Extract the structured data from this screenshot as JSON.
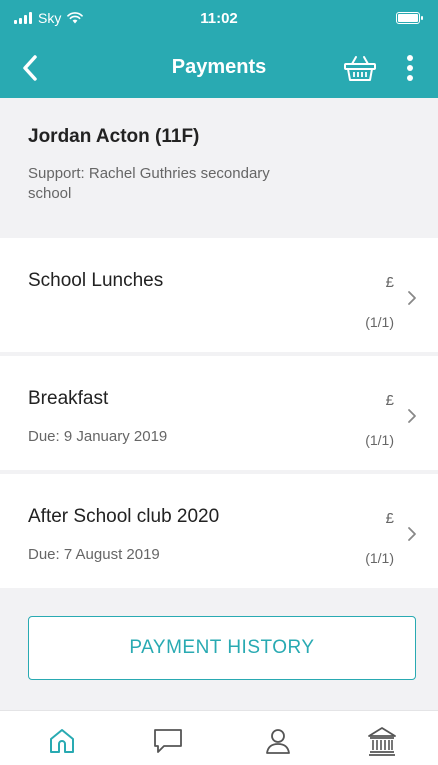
{
  "status_bar": {
    "carrier": "Sky",
    "time": "11:02",
    "icons": [
      "signal-icon",
      "wifi-icon",
      "battery-icon"
    ]
  },
  "nav": {
    "title": "Payments",
    "icons": [
      "back-chevron-icon",
      "basket-icon",
      "more-vertical-icon"
    ]
  },
  "student": {
    "name": "Jordan Acton (11F)",
    "support": "Support: Rachel Guthries secondary school"
  },
  "payments": [
    {
      "title": "School Lunches",
      "due": "",
      "amount": "£",
      "count": "(1/1)"
    },
    {
      "title": "Breakfast",
      "due": "Due: 9 January 2019",
      "amount": "£",
      "count": "(1/1)"
    },
    {
      "title": "After School club 2020",
      "due": "Due: 7 August 2019",
      "amount": "£",
      "count": "(1/1)"
    }
  ],
  "history_button": {
    "label": "PAYMENT HISTORY"
  },
  "tab_bar": {
    "items": [
      "home-icon",
      "chat-icon",
      "profile-icon",
      "bank-icon"
    ]
  },
  "colors": {
    "accent": "#29aab2",
    "background": "#f2f2f4",
    "card": "#ffffff",
    "text_primary": "#222222",
    "text_secondary": "#666666"
  }
}
